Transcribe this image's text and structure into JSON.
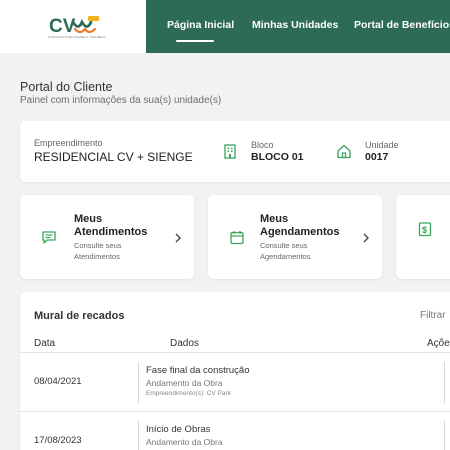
{
  "brand": {
    "logo_text": "CV",
    "tagline": "CONSTRUTORA VERDE E AMARELO",
    "accent": "#2e6b55",
    "icon_accent": "#3aa35a"
  },
  "nav": {
    "items": [
      {
        "label": "Página Inicial",
        "active": true
      },
      {
        "label": "Minhas Unidades",
        "active": false
      },
      {
        "label": "Portal de Benefícios",
        "active": false
      }
    ]
  },
  "page": {
    "title": "Portal do Cliente",
    "subtitle": "Painel com informações da sua(s) unidade(s)"
  },
  "unit_info": {
    "empreendimento_label": "Empreendimento",
    "empreendimento_value": "RESIDENCIAL CV + SIENGE",
    "bloco_label": "Bloco",
    "bloco_value": "BLOCO 01",
    "unidade_label": "Unidade",
    "unidade_value": "0017",
    "icons": [
      "building-icon",
      "home-icon"
    ]
  },
  "quick_actions": [
    {
      "title_line1": "Meus",
      "title_line2": "Atendimentos",
      "sub_line1": "Consulte seus",
      "sub_line2": "Atendimentos",
      "icon": "chat-icon"
    },
    {
      "title_line1": "Meus",
      "title_line2": "Agendamentos",
      "sub_line1": "Consulte seus",
      "sub_line2": "Agendamentos",
      "icon": "calendar-icon"
    },
    {
      "icon": "receipt-icon"
    }
  ],
  "mural": {
    "title": "Mural de recados",
    "filter_label": "Filtrar",
    "columns": {
      "date": "Data",
      "data": "Dados",
      "actions": "Ações"
    },
    "rows": [
      {
        "date": "08/04/2021",
        "title": "Fase final da construção",
        "subtitle": "Andamento da Obra",
        "detail": "Empreendimento(s): CV Park"
      },
      {
        "date": "17/08/2023",
        "title": "Início de Obras",
        "subtitle": "Andamento da Obra",
        "detail": ""
      }
    ]
  }
}
